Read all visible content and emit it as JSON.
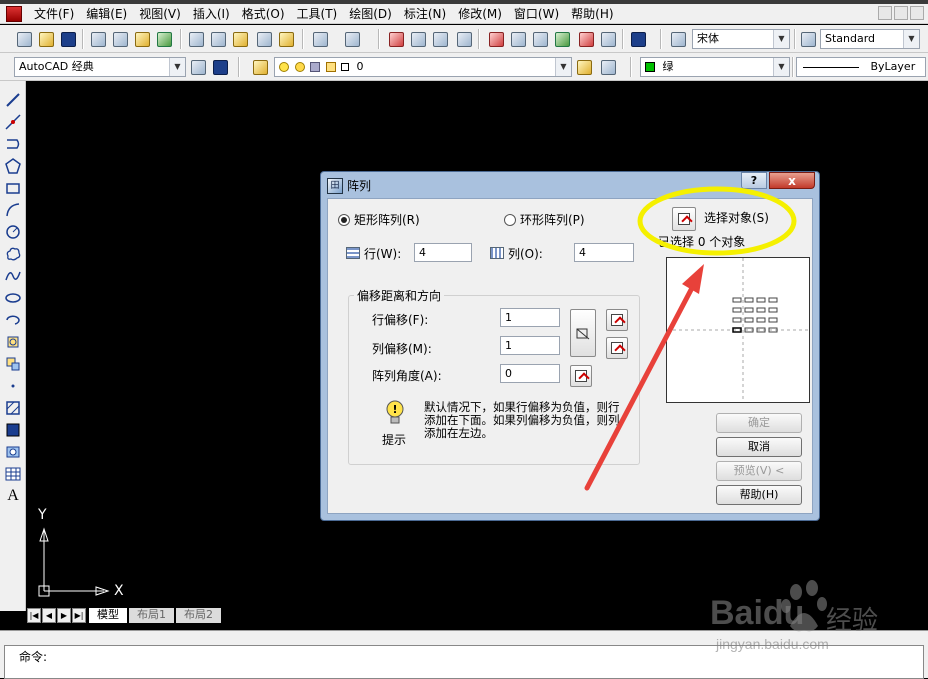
{
  "menubar": {
    "items": [
      "文件(F)",
      "编辑(E)",
      "视图(V)",
      "插入(I)",
      "格式(O)",
      "工具(T)",
      "绘图(D)",
      "标注(N)",
      "修改(M)",
      "窗口(W)",
      "帮助(H)"
    ]
  },
  "toolbar1": {
    "font_name": "宋体",
    "text_style": "Standard"
  },
  "toolbar2": {
    "workspace": "AutoCAD 经典",
    "layer_value": "0",
    "color": "绿",
    "color_swatch": "#00c000",
    "linetype": "ByLayer"
  },
  "left_toolbar": {
    "icons": [
      "line-icon",
      "construction-line-icon",
      "polyline-icon",
      "polygon-icon",
      "rectangle-icon",
      "arc-icon",
      "circle-icon",
      "revcloud-icon",
      "spline-icon",
      "ellipse-icon",
      "ellipse-arc-icon",
      "insert-block-icon",
      "make-block-icon",
      "point-icon",
      "hatch-icon",
      "gradient-icon",
      "region-icon",
      "table-icon",
      "multiline-text-icon"
    ],
    "text_tool": "A"
  },
  "ucs": {
    "y_label": "Y",
    "x_label": "X"
  },
  "layout_tabs": {
    "model": "模型",
    "layout1": "布局1",
    "layout2": "布局2"
  },
  "command": {
    "prompt": "命令:"
  },
  "dialog": {
    "title": "阵列",
    "help_symbol": "?",
    "close_symbol": "x",
    "rect_array_label": "矩形阵列(R)",
    "polar_array_label": "环形阵列(P)",
    "select_objects_label": "选择对象(S)",
    "selected_count_label": "已选择 0 个对象",
    "rows_label": "行(W):",
    "rows_value": "4",
    "cols_label": "列(O):",
    "cols_value": "4",
    "offset_group_label": "偏移距离和方向",
    "row_offset_label": "行偏移(F):",
    "row_offset_value": "1",
    "col_offset_label": "列偏移(M):",
    "col_offset_value": "1",
    "angle_label": "阵列角度(A):",
    "angle_value": "0",
    "tip_label": "提示",
    "tip_text": "默认情况下，如果行偏移为负值，则行添加在下面。如果列偏移为负值，则列添加在左边。",
    "ok_button": "确定",
    "cancel_button": "取消",
    "preview_button": "预览(V) <",
    "help_button": "帮助(H)"
  },
  "annotation": {
    "ellipse_color": "#f5f000",
    "arrow_color": "#e8413a"
  },
  "watermark": {
    "brand": "Baidu",
    "brand_cn": "经验",
    "url": "jingyan.baidu.com"
  }
}
